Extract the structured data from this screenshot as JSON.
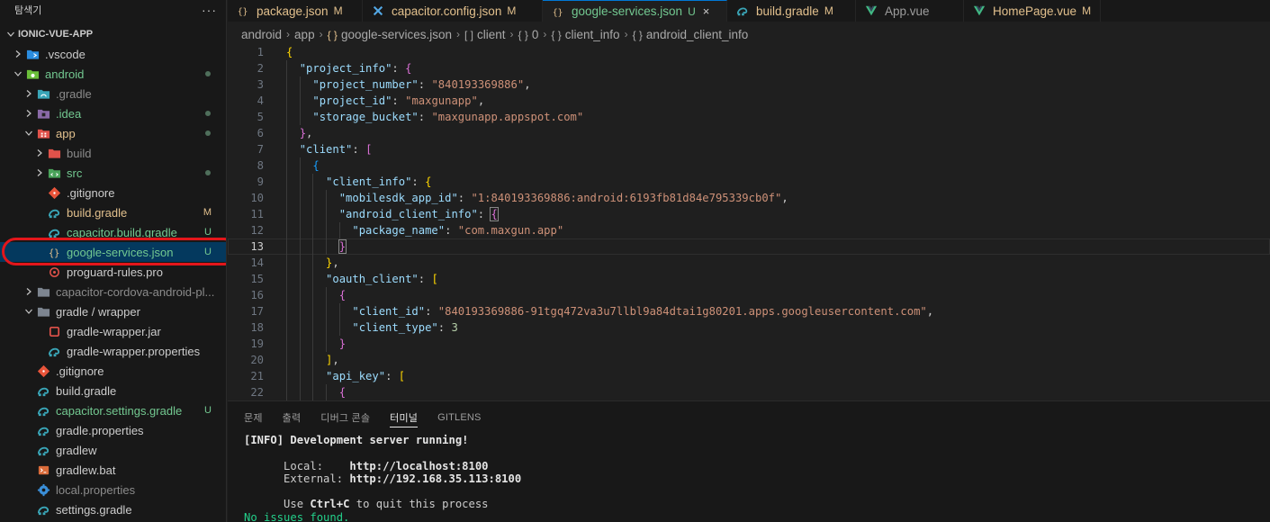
{
  "sidebar": {
    "title": "탐색기",
    "more": "···",
    "tree": [
      {
        "label": "IONIC-VUE-APP",
        "indent": 0,
        "chev": "down",
        "icon": "none",
        "color": "root",
        "root": true
      },
      {
        "label": ".vscode",
        "indent": 1,
        "chev": "right",
        "icon": "vscode-folder-icon",
        "color": "norm"
      },
      {
        "label": "android",
        "indent": 1,
        "chev": "down",
        "icon": "android-folder-icon",
        "color": "untracked",
        "dot": true
      },
      {
        "label": ".gradle",
        "indent": 2,
        "chev": "right",
        "icon": "gradle-folder-icon",
        "color": "dim"
      },
      {
        "label": ".idea",
        "indent": 2,
        "chev": "right",
        "icon": "idea-folder-icon",
        "color": "untracked",
        "dot": true
      },
      {
        "label": "app",
        "indent": 2,
        "chev": "down",
        "icon": "app-folder-icon",
        "color": "mod",
        "dot": true
      },
      {
        "label": "build",
        "indent": 3,
        "chev": "right",
        "icon": "build-folder-icon",
        "color": "dim"
      },
      {
        "label": "src",
        "indent": 3,
        "chev": "right",
        "icon": "src-folder-icon",
        "color": "untracked",
        "dot": true
      },
      {
        "label": ".gitignore",
        "indent": 3,
        "chev": "none",
        "icon": "git-icon",
        "color": "norm"
      },
      {
        "label": "build.gradle",
        "indent": 3,
        "chev": "none",
        "icon": "gradle-icon",
        "color": "mod",
        "badge": "M"
      },
      {
        "label": "capacitor.build.gradle",
        "indent": 3,
        "chev": "none",
        "icon": "gradle-icon",
        "color": "untracked",
        "badge": "U"
      },
      {
        "label": "google-services.json",
        "indent": 3,
        "chev": "none",
        "icon": "json-icon",
        "color": "untracked",
        "badge": "U",
        "selected": true
      },
      {
        "label": "proguard-rules.pro",
        "indent": 3,
        "chev": "none",
        "icon": "proguard-icon",
        "color": "norm"
      },
      {
        "label": "capacitor-cordova-android-pl...",
        "indent": 2,
        "chev": "right",
        "icon": "folder-icon",
        "color": "dim"
      },
      {
        "label": "gradle / wrapper",
        "indent": 2,
        "chev": "down",
        "icon": "folder-icon",
        "color": "norm"
      },
      {
        "label": "gradle-wrapper.jar",
        "indent": 3,
        "chev": "none",
        "icon": "jar-icon",
        "color": "norm"
      },
      {
        "label": "gradle-wrapper.properties",
        "indent": 3,
        "chev": "none",
        "icon": "gradle-icon",
        "color": "norm"
      },
      {
        "label": ".gitignore",
        "indent": 2,
        "chev": "none",
        "icon": "git-icon",
        "color": "norm"
      },
      {
        "label": "build.gradle",
        "indent": 2,
        "chev": "none",
        "icon": "gradle-icon",
        "color": "norm"
      },
      {
        "label": "capacitor.settings.gradle",
        "indent": 2,
        "chev": "none",
        "icon": "gradle-icon",
        "color": "untracked",
        "badge": "U"
      },
      {
        "label": "gradle.properties",
        "indent": 2,
        "chev": "none",
        "icon": "gradle-icon",
        "color": "norm"
      },
      {
        "label": "gradlew",
        "indent": 2,
        "chev": "none",
        "icon": "gradle-icon",
        "color": "norm"
      },
      {
        "label": "gradlew.bat",
        "indent": 2,
        "chev": "none",
        "icon": "terminal-file-icon",
        "color": "norm"
      },
      {
        "label": "local.properties",
        "indent": 2,
        "chev": "none",
        "icon": "settings-gear-icon",
        "color": "dim"
      },
      {
        "label": "settings.gradle",
        "indent": 2,
        "chev": "none",
        "icon": "gradle-icon",
        "color": "norm"
      }
    ]
  },
  "tabs": [
    {
      "name": "package.json",
      "state": "M",
      "icon": "json-icon",
      "kind": "mod"
    },
    {
      "name": "capacitor.config.json",
      "state": "M",
      "icon": "capacitor-icon",
      "kind": "mod"
    },
    {
      "name": "google-services.json",
      "state": "U",
      "icon": "json-icon",
      "kind": "untr",
      "active": true,
      "close": "×"
    },
    {
      "name": "build.gradle",
      "state": "M",
      "icon": "gradle-icon",
      "kind": "mod"
    },
    {
      "name": "App.vue",
      "state": "",
      "icon": "vue-icon",
      "kind": "plain"
    },
    {
      "name": "HomePage.vue",
      "state": "M",
      "icon": "vue-icon",
      "kind": "mod"
    }
  ],
  "breadcrumb": [
    {
      "label": "android",
      "icon": ""
    },
    {
      "label": "app",
      "icon": ""
    },
    {
      "label": "google-services.json",
      "icon": "{ }"
    },
    {
      "label": "client",
      "icon": "[ ]"
    },
    {
      "label": "0",
      "icon": "{ }"
    },
    {
      "label": "client_info",
      "icon": "{ }"
    },
    {
      "label": "android_client_info",
      "icon": "{ }"
    }
  ],
  "editor": {
    "current_line": 13,
    "lines": [
      {
        "n": 1,
        "tokens": [
          [
            "b1",
            "{"
          ]
        ]
      },
      {
        "n": 2,
        "tokens": [
          [
            "p",
            "  "
          ],
          [
            "k",
            "\"project_info\""
          ],
          [
            "p",
            ": "
          ],
          [
            "b2",
            "{"
          ]
        ]
      },
      {
        "n": 3,
        "tokens": [
          [
            "p",
            "    "
          ],
          [
            "k",
            "\"project_number\""
          ],
          [
            "p",
            ": "
          ],
          [
            "s",
            "\"840193369886\""
          ],
          [
            "p",
            ","
          ]
        ]
      },
      {
        "n": 4,
        "tokens": [
          [
            "p",
            "    "
          ],
          [
            "k",
            "\"project_id\""
          ],
          [
            "p",
            ": "
          ],
          [
            "s",
            "\"maxgunapp\""
          ],
          [
            "p",
            ","
          ]
        ]
      },
      {
        "n": 5,
        "tokens": [
          [
            "p",
            "    "
          ],
          [
            "k",
            "\"storage_bucket\""
          ],
          [
            "p",
            ": "
          ],
          [
            "s",
            "\"maxgunapp.appspot.com\""
          ]
        ]
      },
      {
        "n": 6,
        "tokens": [
          [
            "p",
            "  "
          ],
          [
            "b2",
            "}"
          ],
          [
            "p",
            ","
          ]
        ]
      },
      {
        "n": 7,
        "tokens": [
          [
            "p",
            "  "
          ],
          [
            "k",
            "\"client\""
          ],
          [
            "p",
            ": "
          ],
          [
            "b2",
            "["
          ]
        ]
      },
      {
        "n": 8,
        "tokens": [
          [
            "p",
            "    "
          ],
          [
            "b3",
            "{"
          ]
        ]
      },
      {
        "n": 9,
        "tokens": [
          [
            "p",
            "      "
          ],
          [
            "k",
            "\"client_info\""
          ],
          [
            "p",
            ": "
          ],
          [
            "b1",
            "{"
          ]
        ]
      },
      {
        "n": 10,
        "tokens": [
          [
            "p",
            "        "
          ],
          [
            "k",
            "\"mobilesdk_app_id\""
          ],
          [
            "p",
            ": "
          ],
          [
            "s",
            "\"1:840193369886:android:6193fb81d84e795339cb0f\""
          ],
          [
            "p",
            ","
          ]
        ]
      },
      {
        "n": 11,
        "tokens": [
          [
            "p",
            "        "
          ],
          [
            "k",
            "\"android_client_info\""
          ],
          [
            "p",
            ": "
          ],
          [
            "b2m",
            "{"
          ]
        ]
      },
      {
        "n": 12,
        "tokens": [
          [
            "p",
            "          "
          ],
          [
            "k",
            "\"package_name\""
          ],
          [
            "p",
            ": "
          ],
          [
            "s",
            "\"com.maxgun.app\""
          ]
        ]
      },
      {
        "n": 13,
        "tokens": [
          [
            "p",
            "        "
          ],
          [
            "b2m",
            "}"
          ]
        ]
      },
      {
        "n": 14,
        "tokens": [
          [
            "p",
            "      "
          ],
          [
            "b1",
            "}"
          ],
          [
            "p",
            ","
          ]
        ]
      },
      {
        "n": 15,
        "tokens": [
          [
            "p",
            "      "
          ],
          [
            "k",
            "\"oauth_client\""
          ],
          [
            "p",
            ": "
          ],
          [
            "b1",
            "["
          ]
        ]
      },
      {
        "n": 16,
        "tokens": [
          [
            "p",
            "        "
          ],
          [
            "b2",
            "{"
          ]
        ]
      },
      {
        "n": 17,
        "tokens": [
          [
            "p",
            "          "
          ],
          [
            "k",
            "\"client_id\""
          ],
          [
            "p",
            ": "
          ],
          [
            "s",
            "\"840193369886-91tgq472va3u7llbl9a84dtai1g80201.apps.googleusercontent.com\""
          ],
          [
            "p",
            ","
          ]
        ]
      },
      {
        "n": 18,
        "tokens": [
          [
            "p",
            "          "
          ],
          [
            "k",
            "\"client_type\""
          ],
          [
            "p",
            ": "
          ],
          [
            "n",
            "3"
          ]
        ]
      },
      {
        "n": 19,
        "tokens": [
          [
            "p",
            "        "
          ],
          [
            "b2",
            "}"
          ]
        ]
      },
      {
        "n": 20,
        "tokens": [
          [
            "p",
            "      "
          ],
          [
            "b1",
            "]"
          ],
          [
            "p",
            ","
          ]
        ]
      },
      {
        "n": 21,
        "tokens": [
          [
            "p",
            "      "
          ],
          [
            "k",
            "\"api_key\""
          ],
          [
            "p",
            ": "
          ],
          [
            "b1",
            "["
          ]
        ]
      },
      {
        "n": 22,
        "tokens": [
          [
            "p",
            "        "
          ],
          [
            "b2",
            "{"
          ]
        ]
      }
    ]
  },
  "panel": {
    "tabs": [
      {
        "label": "문제"
      },
      {
        "label": "출력"
      },
      {
        "label": "디버그 콘솔"
      },
      {
        "label": "터미널",
        "active": true
      },
      {
        "label": "GITLENS"
      }
    ],
    "terminal": {
      "info_tag": "INFO",
      "line1": "Development server running!",
      "local_label": "Local:",
      "local_url": "http://localhost:8100",
      "external_label": "External:",
      "external_url": "http://192.168.35.113:8100",
      "quit_prefix": "Use ",
      "quit_key": "Ctrl+C",
      "quit_suffix": " to quit this process",
      "no_issues": "No issues found."
    }
  },
  "colors": {
    "accent": "#0078d4",
    "modified": "#e2c08d",
    "untracked": "#73c991",
    "highlight_ring": "#e3161b"
  }
}
